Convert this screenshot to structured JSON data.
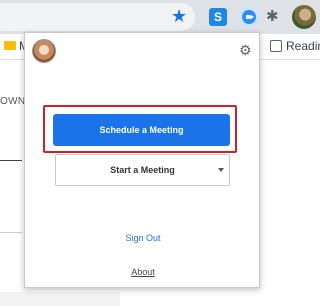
{
  "browser": {
    "bookmarks_left_label": "M",
    "bookmarks_right_label": "Readin",
    "extension_s_label": "S"
  },
  "page_behind": {
    "partial_text": "OWN"
  },
  "popup": {
    "schedule_button_label": "Schedule a Meeting",
    "start_button_label": "Start a Meeting",
    "sign_out_label": "Sign Out",
    "about_label": "About"
  },
  "colors": {
    "primary_button": "#1a73e8",
    "highlight_border": "#c8222b",
    "link": "#2d6bd6"
  },
  "icons": [
    "star-icon",
    "extension-s-icon",
    "zoom-extension-icon",
    "puzzle-icon",
    "profile-avatar",
    "folder-icon",
    "reading-list-icon",
    "popup-avatar",
    "gear-icon",
    "chevron-down-icon"
  ]
}
